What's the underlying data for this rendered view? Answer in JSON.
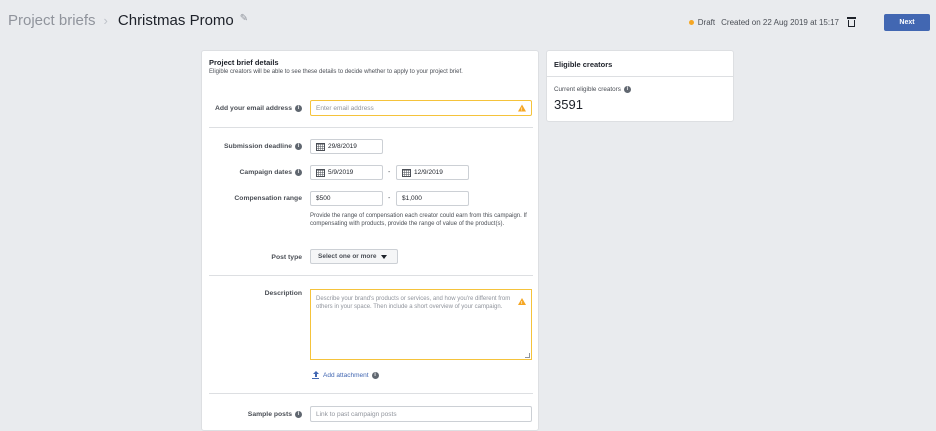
{
  "header": {
    "breadcrumb_parent": "Project briefs",
    "breadcrumb_separator": "›",
    "title": "Christmas Promo",
    "status": "Draft",
    "created": "Created on 22 Aug 2019 at 15:17",
    "next_label": "Next"
  },
  "brief": {
    "title": "Project brief details",
    "subtitle": "Eligible creators will be able to see these details to decide whether to apply to your project brief.",
    "email": {
      "label": "Add your email address",
      "placeholder": "Enter email address",
      "value": ""
    },
    "deadline": {
      "label": "Submission deadline",
      "value": "29/8/2019"
    },
    "campaign": {
      "label": "Campaign dates",
      "start": "5/9/2019",
      "end": "12/9/2019",
      "separator": "-"
    },
    "compensation": {
      "label": "Compensation range",
      "min": "$500",
      "max": "$1,000",
      "separator": "-",
      "help": "Provide the range of compensation each creator could earn from this campaign. If compensating with products, provide the range of value of the product(s)."
    },
    "post_type": {
      "label": "Post type",
      "select_label": "Select one or more"
    },
    "description": {
      "label": "Description",
      "placeholder": "Describe your brand's products or services, and how you're different from others in your space. Then include a short overview of your campaign."
    },
    "attachment_label": "Add attachment",
    "sample_posts": {
      "label": "Sample posts",
      "placeholder": "Link to past campaign posts"
    }
  },
  "eligible": {
    "title": "Eligible creators",
    "label": "Current eligible creators",
    "count": "3591"
  },
  "colors": {
    "accent": "#4267b2",
    "warning": "#f5a623",
    "background": "#e9ebee"
  },
  "icons": {
    "edit": "pencil-icon",
    "delete": "trash-icon",
    "info": "info-icon",
    "calendar": "calendar-icon",
    "warning": "warning-icon",
    "dropdown": "caret-down-icon",
    "upload": "upload-icon"
  }
}
